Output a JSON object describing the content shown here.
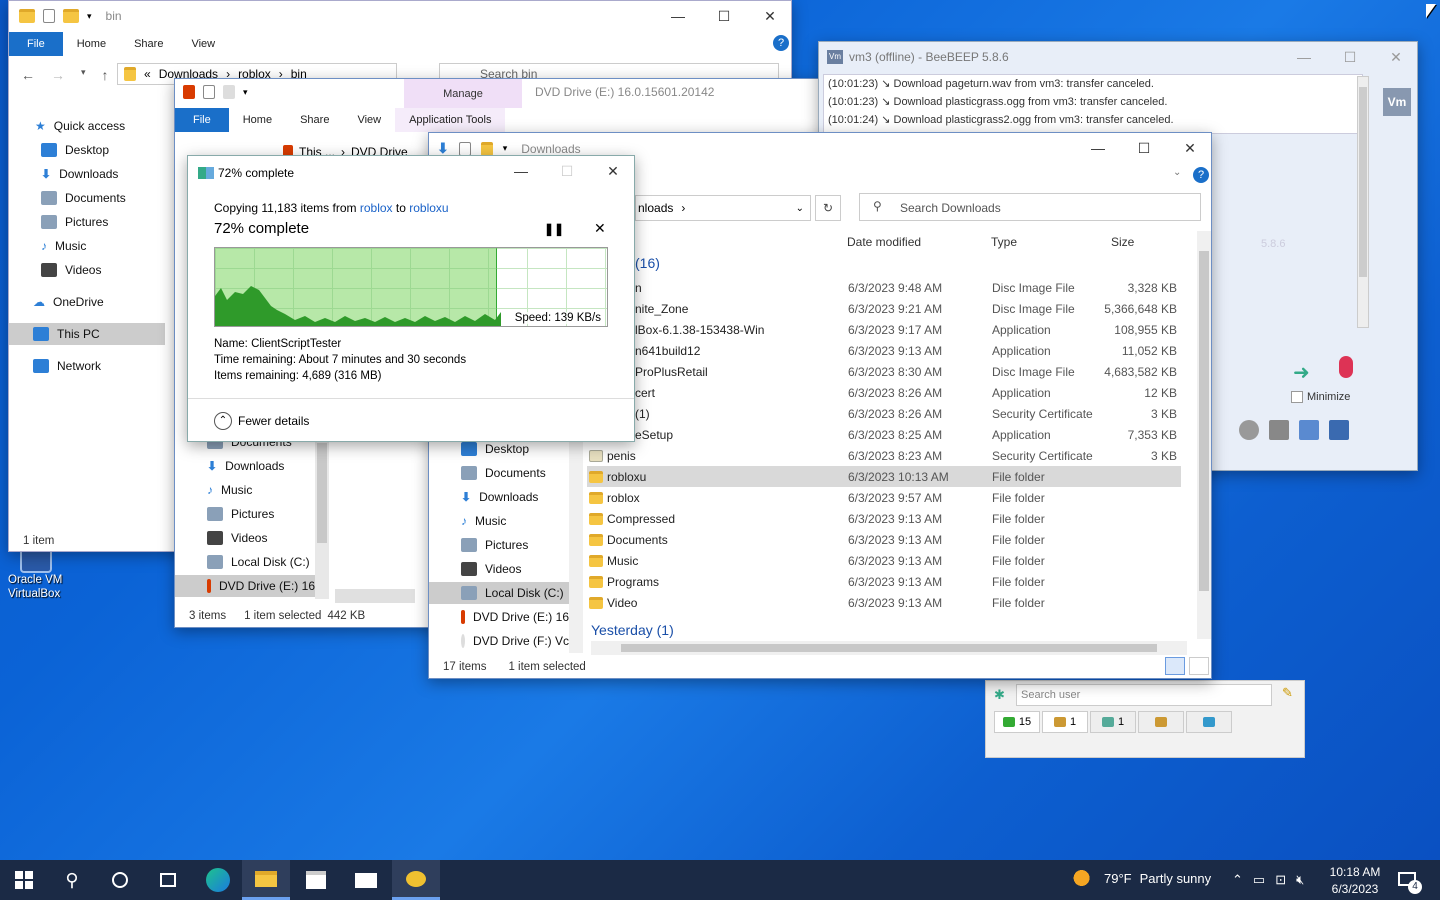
{
  "desktop": {
    "icon_label_1": "Oracle VM",
    "icon_label_2": "VirtualBox"
  },
  "bin_win": {
    "title": "bin",
    "tabs": [
      "File",
      "Home",
      "Share",
      "View"
    ],
    "breadcrumb": [
      "Downloads",
      "roblox",
      "bin"
    ],
    "search_placeholder": "Search bin",
    "nav": [
      {
        "label": "Quick access"
      },
      {
        "label": "Desktop"
      },
      {
        "label": "Downloads"
      },
      {
        "label": "Documents"
      },
      {
        "label": "Pictures"
      },
      {
        "label": "Music"
      },
      {
        "label": "Videos"
      },
      {
        "label": "OneDrive"
      },
      {
        "label": "This PC"
      },
      {
        "label": "Network"
      }
    ],
    "status": "1 item"
  },
  "dvd_win": {
    "manage": "Manage",
    "app_tools": "Application Tools",
    "title": "DVD Drive (E:) 16.0.15601.20142",
    "tabs": [
      "File",
      "Home",
      "Share",
      "View"
    ],
    "breadcrumb": [
      "This ...",
      "DVD Drive"
    ],
    "nav": [
      {
        "label": "Documents"
      },
      {
        "label": "Downloads"
      },
      {
        "label": "Music"
      },
      {
        "label": "Pictures"
      },
      {
        "label": "Videos"
      },
      {
        "label": "Local Disk (C:)"
      },
      {
        "label": "DVD Drive (E:) 16"
      }
    ],
    "status_items": "3 items",
    "status_selected": "1 item selected",
    "status_size": "442 KB"
  },
  "dl_win": {
    "title": "Downloads",
    "breadcrumb": "nloads",
    "search_placeholder": "Search Downloads",
    "columns": {
      "date": "Date modified",
      "type": "Type",
      "size": "Size"
    },
    "group_recent": "(16)",
    "group_yesterday": "Yesterday (1)",
    "rows": [
      {
        "name": "n",
        "date": "6/3/2023 9:48 AM",
        "type": "Disc Image File",
        "size": "3,328 KB",
        "icon": "file"
      },
      {
        "name": "nite_Zone",
        "date": "6/3/2023 9:21 AM",
        "type": "Disc Image File",
        "size": "5,366,648 KB",
        "icon": "file"
      },
      {
        "name": "lBox-6.1.38-153438-Win",
        "date": "6/3/2023 9:17 AM",
        "type": "Application",
        "size": "108,955 KB",
        "icon": "file"
      },
      {
        "name": "n641build12",
        "date": "6/3/2023 9:13 AM",
        "type": "Application",
        "size": "11,052 KB",
        "icon": "file"
      },
      {
        "name": "ProPlusRetail",
        "date": "6/3/2023 8:30 AM",
        "type": "Disc Image File",
        "size": "4,683,582 KB",
        "icon": "file"
      },
      {
        "name": "cert",
        "date": "6/3/2023 8:26 AM",
        "type": "Application",
        "size": "12 KB",
        "icon": "file"
      },
      {
        "name": "(1)",
        "date": "6/3/2023 8:26 AM",
        "type": "Security Certificate",
        "size": "3 KB",
        "icon": "file"
      },
      {
        "name": "eSetup",
        "date": "6/3/2023 8:25 AM",
        "type": "Application",
        "size": "7,353 KB",
        "icon": "file"
      },
      {
        "name": "penis",
        "date": "6/3/2023 8:23 AM",
        "type": "Security Certificate",
        "size": "3 KB",
        "icon": "cert"
      },
      {
        "name": "robloxu",
        "date": "6/3/2023 10:13 AM",
        "type": "File folder",
        "size": "",
        "icon": "folder"
      },
      {
        "name": "roblox",
        "date": "6/3/2023 9:57 AM",
        "type": "File folder",
        "size": "",
        "icon": "folder"
      },
      {
        "name": "Compressed",
        "date": "6/3/2023 9:13 AM",
        "type": "File folder",
        "size": "",
        "icon": "folder"
      },
      {
        "name": "Documents",
        "date": "6/3/2023 9:13 AM",
        "type": "File folder",
        "size": "",
        "icon": "folder"
      },
      {
        "name": "Music",
        "date": "6/3/2023 9:13 AM",
        "type": "File folder",
        "size": "",
        "icon": "folder"
      },
      {
        "name": "Programs",
        "date": "6/3/2023 9:13 AM",
        "type": "File folder",
        "size": "",
        "icon": "folder"
      },
      {
        "name": "Video",
        "date": "6/3/2023 9:13 AM",
        "type": "File folder",
        "size": "",
        "icon": "folder"
      }
    ],
    "nav": [
      {
        "label": "Desktop"
      },
      {
        "label": "Documents"
      },
      {
        "label": "Downloads"
      },
      {
        "label": "Music"
      },
      {
        "label": "Pictures"
      },
      {
        "label": "Videos"
      },
      {
        "label": "Local Disk (C:)"
      },
      {
        "label": "DVD Drive (E:) 16"
      },
      {
        "label": "DVD Drive (F:) Vc"
      }
    ],
    "status_items": "17 items",
    "status_selected": "1 item selected"
  },
  "copy": {
    "title": "72% complete",
    "desc_prefix": "Copying 11,183 items from ",
    "from": "roblox",
    "to_word": " to ",
    "to": "robloxu",
    "heading": "72% complete",
    "progress": 0.72,
    "speed": "Speed: 139 KB/s",
    "name": "Name:  ClientScriptTester",
    "time": "Time remaining:  About 7 minutes and 30 seconds",
    "items": "Items remaining:  4,689 (316 MB)",
    "fewer": "Fewer details"
  },
  "beebeep": {
    "title": "vm3 (offline) - BeeBEEP 5.8.6",
    "vm_badge": "Vm",
    "version_hint": "5.8.6",
    "log": [
      {
        "time": "(10:01:23)",
        "text": "Download pageturn.wav from vm3: transfer canceled."
      },
      {
        "time": "(10:01:23)",
        "text": "Download plasticgrass.ogg from vm3: transfer canceled."
      },
      {
        "time": "(10:01:24)",
        "text": "Download plasticgrass2.ogg from vm3: transfer canceled."
      }
    ],
    "minimize": "Minimize",
    "search_user_placeholder": "Search user",
    "count1": "15",
    "count2": "1",
    "count3": "1"
  },
  "taskbar": {
    "weather_temp": "79°F",
    "weather_text": "Partly sunny",
    "time": "10:18 AM",
    "date": "6/3/2023",
    "notif_count": "4"
  }
}
